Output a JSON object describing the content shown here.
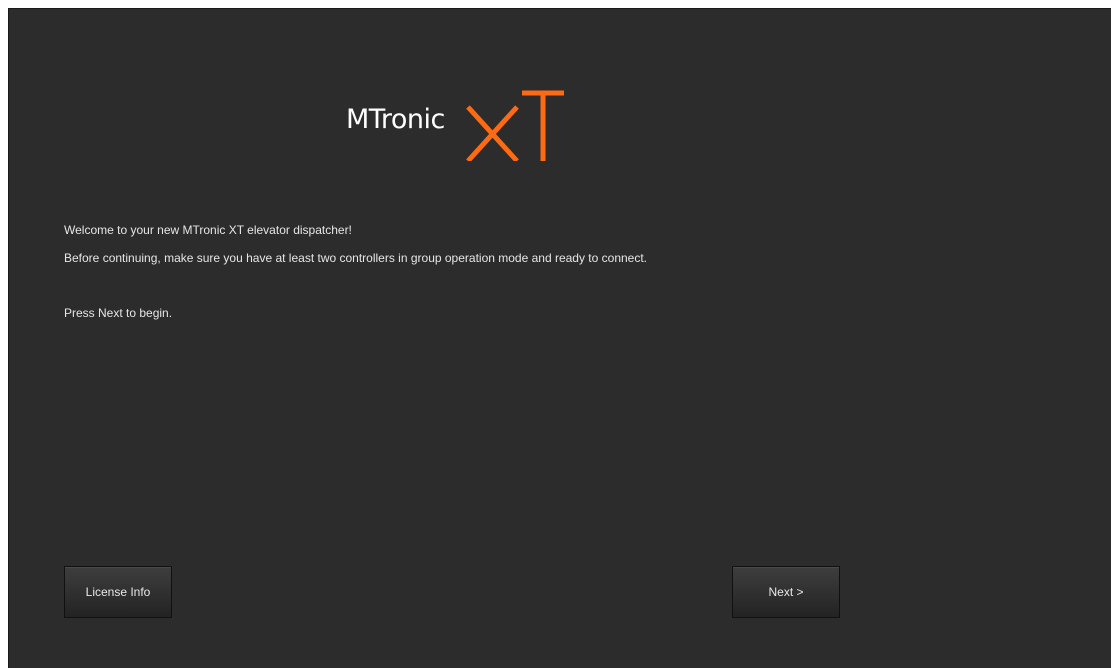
{
  "logo": {
    "main_text": "MTronic",
    "suffix_text": "XT",
    "suffix_color": "#ff6a13",
    "main_color": "#ffffff"
  },
  "content": {
    "welcome": "Welcome to your new MTronic XT elevator dispatcher!",
    "instruction": "Before continuing, make sure you have at least two controllers in group operation mode and ready to connect.",
    "press_next": "Press Next to begin."
  },
  "buttons": {
    "license_label": "License Info",
    "next_label": "Next >"
  },
  "colors": {
    "background": "#2c2c2c",
    "text": "#e6e6e6",
    "accent": "#ff6a13"
  }
}
